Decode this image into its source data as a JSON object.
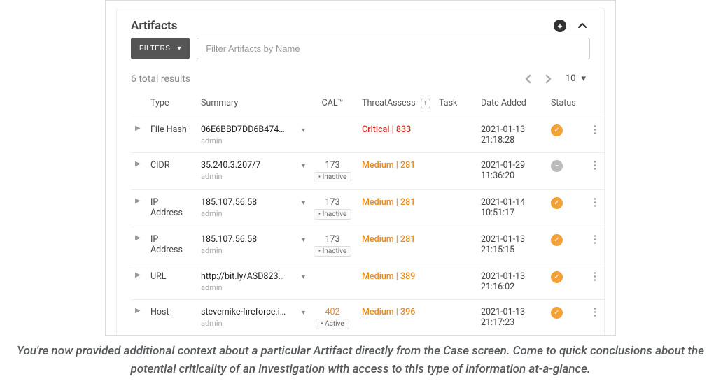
{
  "panel": {
    "title": "Artifacts",
    "filters_btn": "FILTERS",
    "filter_placeholder": "Filter Artifacts by Name",
    "results_text": "6 total results",
    "page_size": "10"
  },
  "columns": {
    "type": "Type",
    "summary": "Summary",
    "cal": "CAL™",
    "threat": "ThreatAssess",
    "task": "Task",
    "date": "Date Added",
    "status": "Status"
  },
  "rows": [
    {
      "type": "File Hash",
      "summary": "06E6BBD7DD6B474…",
      "sub": "admin",
      "cal_score": "",
      "cal_state": "",
      "threat_label": "Critical | 833",
      "threat_class": "threat-crit",
      "date": "2021-01-13 21:18:28",
      "status": "active"
    },
    {
      "type": "CIDR",
      "summary": "35.240.3.207/7",
      "sub": "admin",
      "cal_score": "173",
      "cal_state": "Inactive",
      "threat_label": "Medium | 281",
      "threat_class": "threat-med",
      "date": "2021-01-29 11:36:20",
      "status": "inactive"
    },
    {
      "type": "IP Address",
      "summary": "185.107.56.58",
      "sub": "admin",
      "cal_score": "173",
      "cal_state": "Inactive",
      "threat_label": "Medium | 281",
      "threat_class": "threat-med",
      "date": "2021-01-14 10:51:17",
      "status": "active"
    },
    {
      "type": "IP Address",
      "summary": "185.107.56.58",
      "sub": "admin",
      "cal_score": "173",
      "cal_state": "Inactive",
      "threat_label": "Medium | 281",
      "threat_class": "threat-med",
      "date": "2021-01-13 21:15:15",
      "status": "active"
    },
    {
      "type": "URL",
      "summary": "http://bit.ly/ASD823…",
      "sub": "admin",
      "cal_score": "",
      "cal_state": "",
      "threat_label": "Medium | 389",
      "threat_class": "threat-med",
      "date": "2021-01-13 21:16:02",
      "status": "active"
    },
    {
      "type": "Host",
      "summary": "stevemike-fireforce.i…",
      "sub": "admin",
      "cal_score": "402",
      "cal_score_class": "orange",
      "cal_state": "Active",
      "threat_label": "Medium | 396",
      "threat_class": "threat-med",
      "date": "2021-01-13 21:17:23",
      "status": "active"
    }
  ],
  "caption": "You're now provided additional context about a particular Artifact directly from the Case screen. Come to quick conclusions about the potential criticality of an investigation with access to this type of information at-a-glance."
}
